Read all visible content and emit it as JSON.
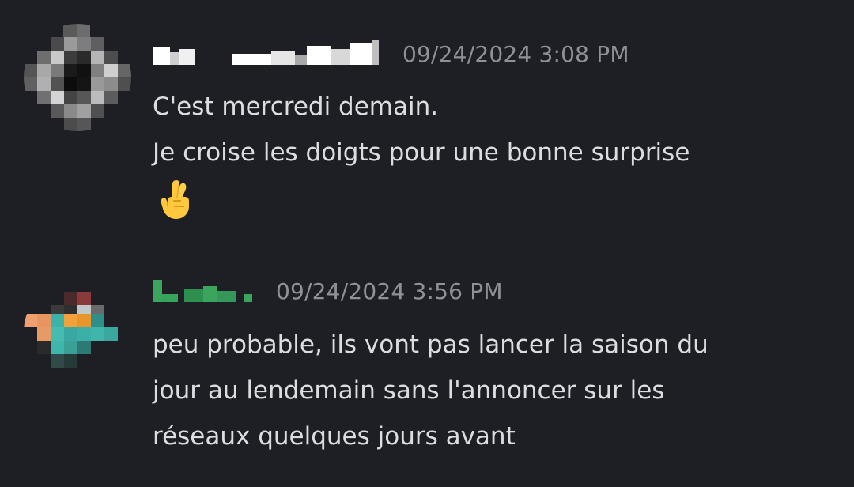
{
  "messages": [
    {
      "timestamp": "09/24/2024 3:08 PM",
      "lines": [
        "C'est mercredi demain.",
        "Je croise les doigts pour une bonne surprise"
      ],
      "emoji": "crossed-fingers"
    },
    {
      "timestamp": "09/24/2024 3:56 PM",
      "lines": [
        "peu probable, ils vont pas lancer la saison du",
        "jour au lendemain sans l'annoncer sur les",
        "réseaux quelques jours avant"
      ]
    }
  ],
  "colors": {
    "background": "#1e1f24",
    "text": "#dbdee1",
    "timestamp": "#8e9198",
    "username2": "#3ba55d"
  }
}
